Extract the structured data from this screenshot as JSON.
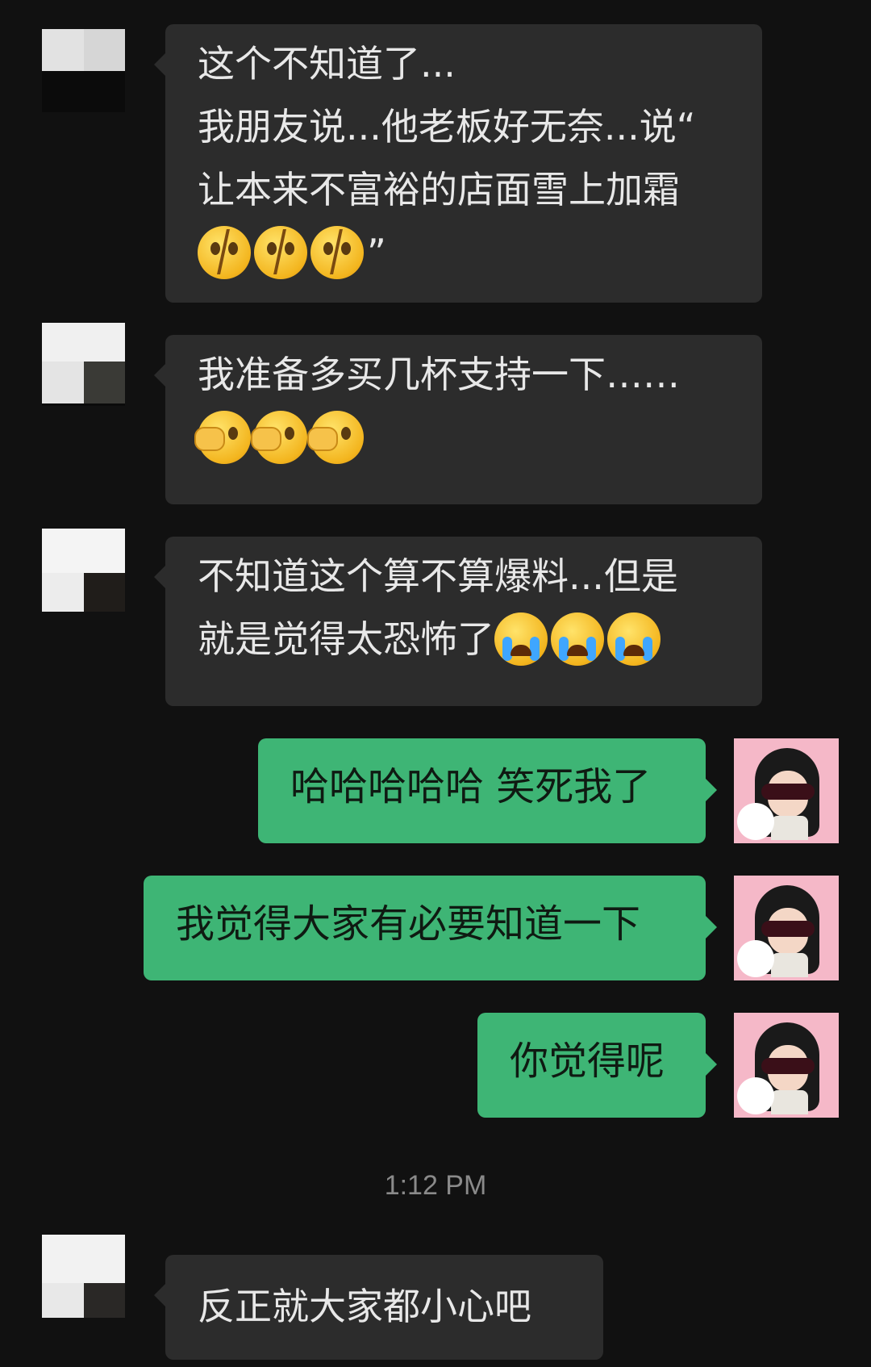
{
  "messages": [
    {
      "direction": "in",
      "lines": [
        "这个不知道了...",
        "我朋友说...他老板好无奈...说“",
        "让本来不富裕的店面雪上加霜"
      ],
      "trailing_text": "”",
      "emojis": [
        "broken-heart-face-emoji",
        "broken-heart-face-emoji",
        "broken-heart-face-emoji"
      ]
    },
    {
      "direction": "in",
      "lines": [
        "我准备多买几杯支持一下……"
      ],
      "emojis": [
        "facepalm-peek-emoji",
        "facepalm-peek-emoji",
        "facepalm-peek-emoji"
      ]
    },
    {
      "direction": "in",
      "lines": [
        "不知道这个算不算爆料...但是",
        "就是觉得太恐怖了"
      ],
      "emojis": [
        "crying-face-emoji",
        "crying-face-emoji",
        "crying-face-emoji"
      ]
    },
    {
      "direction": "out",
      "text": "哈哈哈哈哈 笑死我了"
    },
    {
      "direction": "out",
      "text": "我觉得大家有必要知道一下"
    },
    {
      "direction": "out",
      "text": "你觉得呢"
    },
    {
      "direction": "in",
      "text": "反正就大家都小心吧"
    }
  ],
  "timestamp": "1:12 PM",
  "colors": {
    "background": "#111111",
    "incoming_bubble": "#2c2c2c",
    "outgoing_bubble": "#3eb575",
    "timestamp_text": "#8a8a8a"
  }
}
